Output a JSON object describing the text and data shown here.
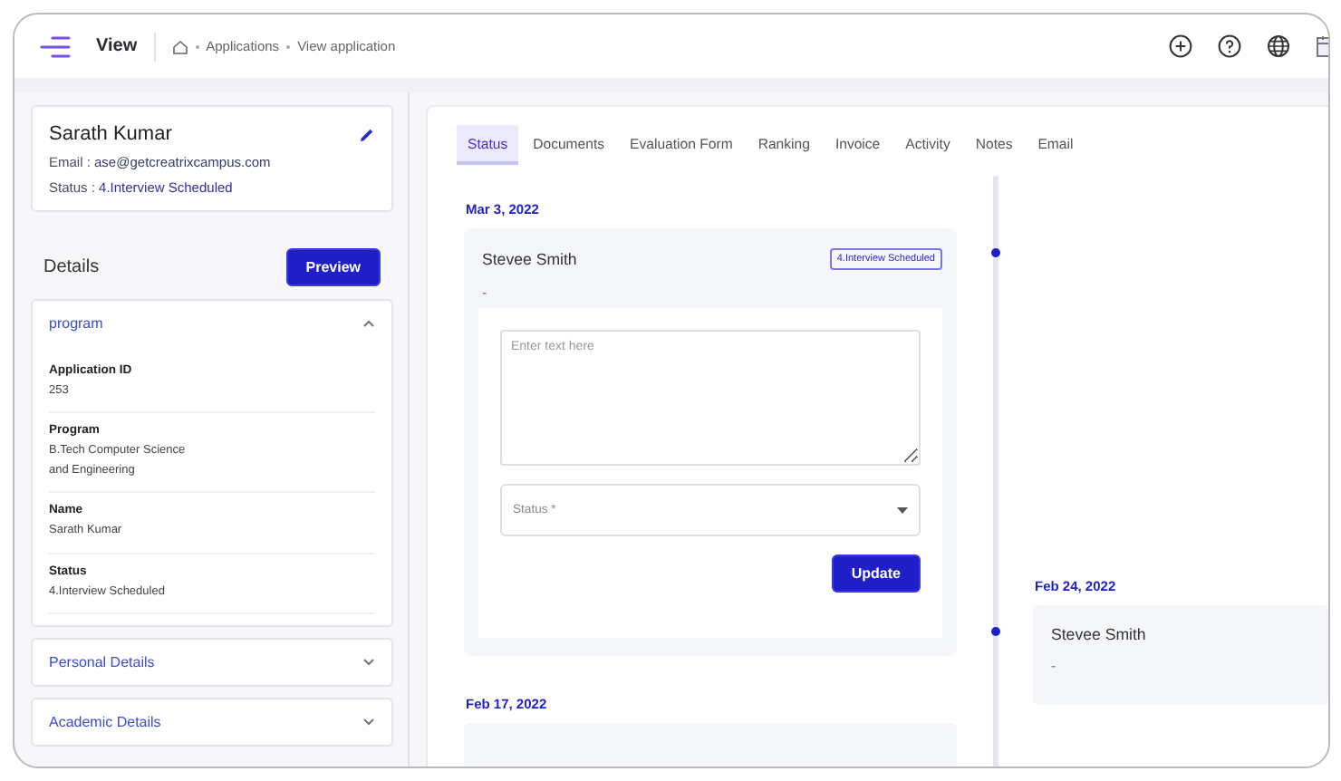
{
  "header": {
    "title": "View",
    "breadcrumb": [
      "Applications",
      "View application"
    ]
  },
  "profile": {
    "name": "Sarath Kumar",
    "email_label": "Email :",
    "email": "ase@getcreatrixcampus.com",
    "status_label": "Status :",
    "status": "4.Interview Scheduled"
  },
  "details": {
    "title": "Details",
    "preview_button": "Preview",
    "sections": [
      {
        "title": "program",
        "expanded": true,
        "fields": [
          {
            "label": "Application ID",
            "value": "253"
          },
          {
            "label": "Program",
            "value": "B.Tech Computer Science and Engineering"
          },
          {
            "label": "Name",
            "value": "Sarath Kumar"
          },
          {
            "label": "Status",
            "value": "4.Interview Scheduled"
          }
        ]
      },
      {
        "title": "Personal Details",
        "expanded": false
      },
      {
        "title": "Academic Details",
        "expanded": false
      }
    ]
  },
  "tabs": [
    {
      "label": "Status",
      "selected": true
    },
    {
      "label": "Documents",
      "selected": false
    },
    {
      "label": "Evaluation Form",
      "selected": false
    },
    {
      "label": "Ranking",
      "selected": false
    },
    {
      "label": "Invoice",
      "selected": false
    },
    {
      "label": "Activity",
      "selected": false
    },
    {
      "label": "Notes",
      "selected": false
    },
    {
      "label": "Email",
      "selected": false
    }
  ],
  "timeline": [
    {
      "kind": "left",
      "date": "Mar 3, 2022",
      "person": "Stevee Smith",
      "badge": "4.Interview Scheduled",
      "note": "-",
      "form": {
        "placeholder": "Enter text here",
        "select_placeholder": "Status *",
        "button": "Update"
      }
    },
    {
      "kind": "right",
      "date": "Feb 24, 2022",
      "person": "Stevee Smith",
      "note": "-"
    },
    {
      "kind": "left",
      "date": "Feb 17, 2022"
    }
  ]
}
